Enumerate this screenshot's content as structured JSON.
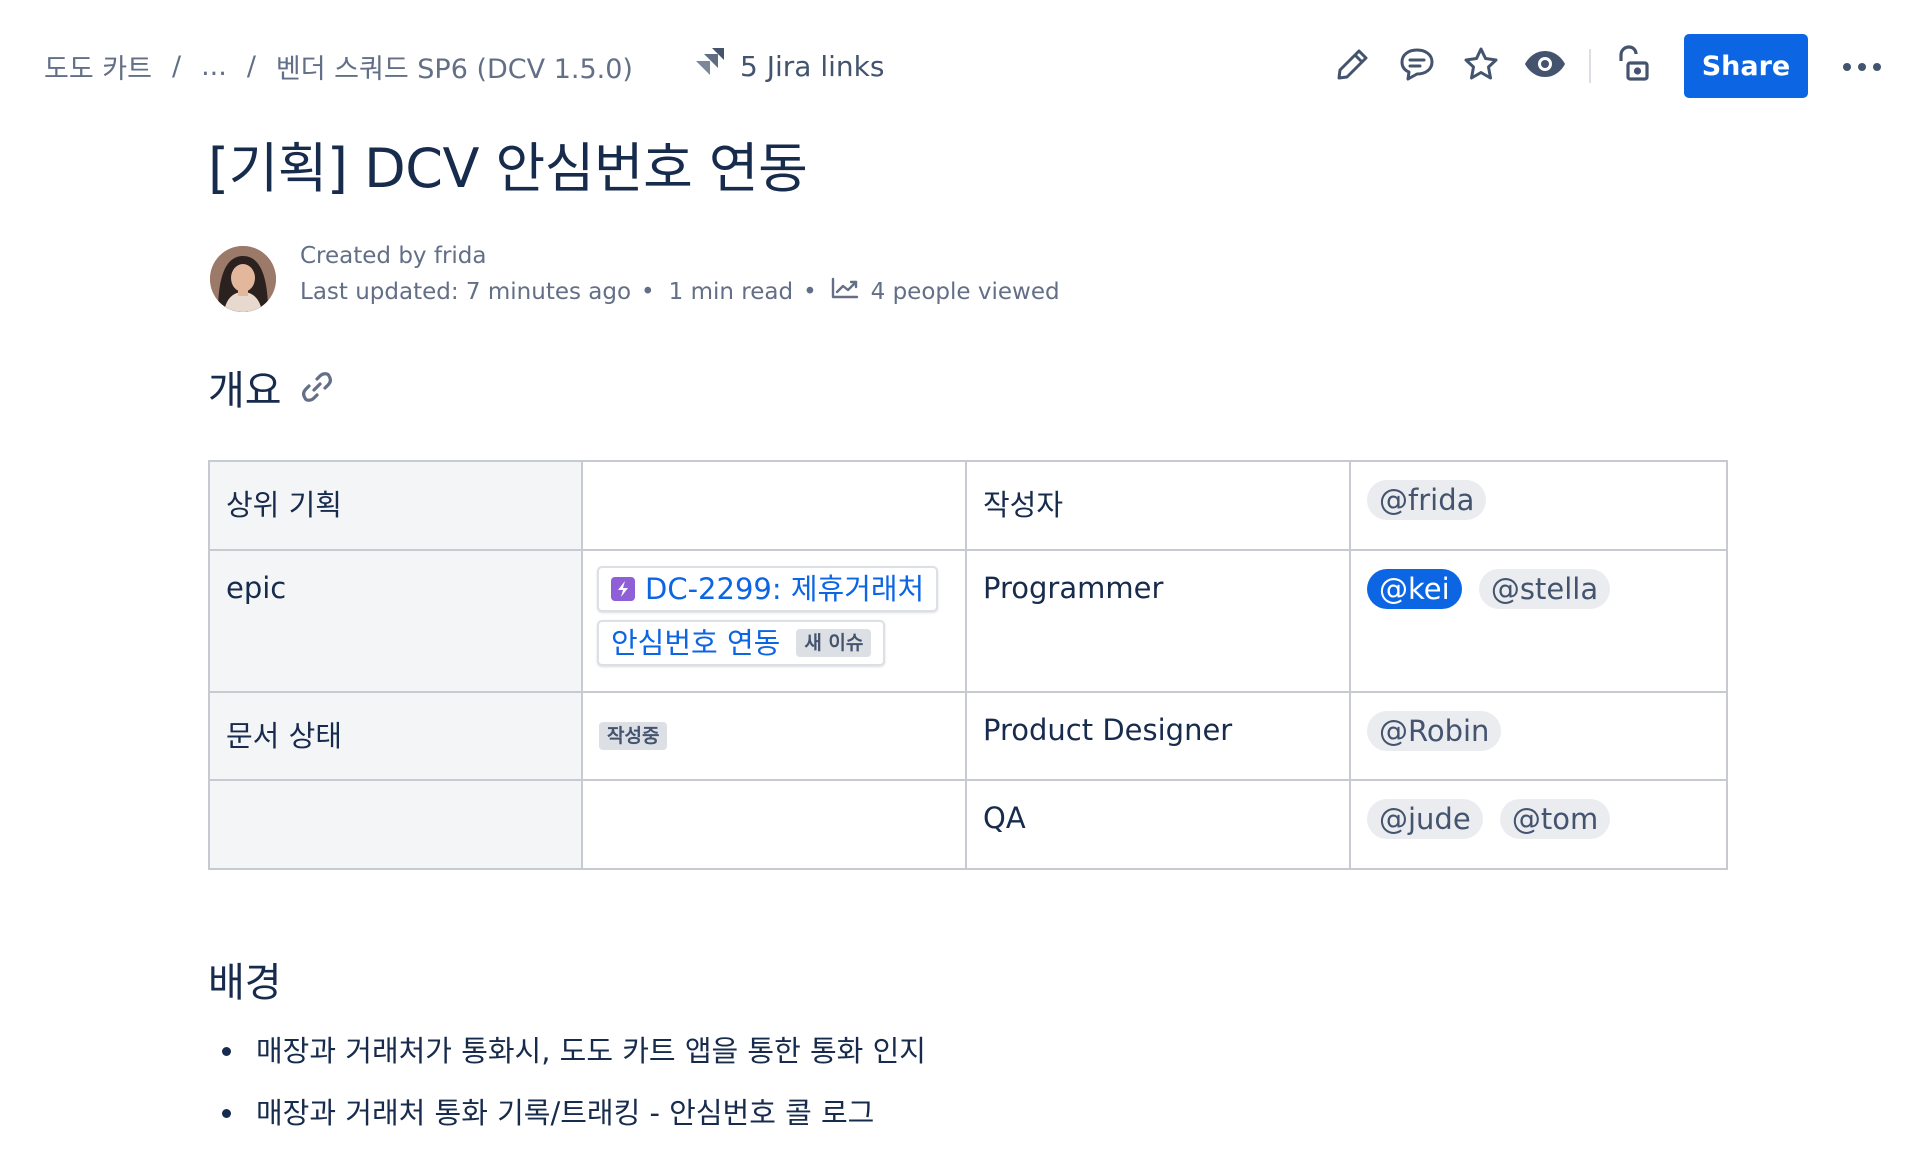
{
  "breadcrumb": {
    "items": [
      "도도 카트",
      "...",
      "벤더 스쿼드 SP6 (DCV 1.5.0)"
    ],
    "separator": "/"
  },
  "header": {
    "jira_links": "5 Jira links",
    "share_label": "Share",
    "icons": [
      "pencil-icon",
      "comment-icon",
      "star-icon",
      "eye-icon",
      "unlock-icon",
      "more-icon"
    ]
  },
  "page": {
    "title": "[기획] DCV 안심번호 연동"
  },
  "meta": {
    "created_by": "Created by frida",
    "last_updated": "Last updated: 7 minutes ago",
    "dot": "•",
    "read_time": "1 min read",
    "viewed": "4 people viewed"
  },
  "overview": {
    "heading": "개요",
    "table": {
      "parent_plan_label": "상위 기획",
      "author_label": "작성자",
      "author": [
        "@frida"
      ],
      "epic_label": "epic",
      "epic_issue_line1": "DC-2299: 제휴거래처",
      "epic_issue_line2": "안심번호 연동",
      "epic_issue_badge": "새 이슈",
      "programmer_label": "Programmer",
      "programmers": [
        "@kei",
        "@stella"
      ],
      "doc_status_label": "문서 상태",
      "doc_status": "작성중",
      "product_designer_label": "Product Designer",
      "product_designers": [
        "@Robin"
      ],
      "qa_label": "QA",
      "qa": [
        "@jude",
        "@tom"
      ]
    }
  },
  "background": {
    "heading": "배경",
    "bullets": [
      "매장과 거래처가 통화시, 도도 카트 앱을 통한 통화 인지",
      "매장과 거래처 통화 기록/트래킹 - 안심번호 콜 로그"
    ]
  },
  "colors": {
    "primary": "#0c66e4",
    "text": "#172b4d",
    "subtle": "#626f86",
    "epic": "#8f5fd8",
    "table_header_bg": "#f4f5f7"
  }
}
